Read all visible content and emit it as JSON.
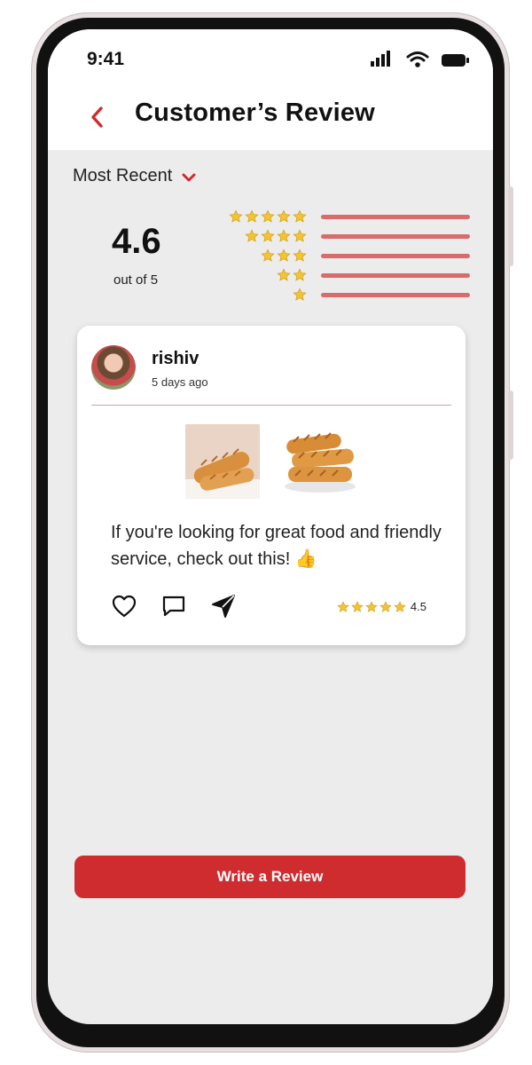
{
  "status_bar": {
    "time": "9:41"
  },
  "header": {
    "title": "Customer’s Review",
    "back_icon": "chevron-left-icon"
  },
  "sort": {
    "label": "Most Recent",
    "icon": "chevron-down-icon"
  },
  "summary": {
    "rating": "4.6",
    "out_of": "out of 5",
    "breakdown": [
      {
        "stars": 5,
        "fill": 1.0
      },
      {
        "stars": 4,
        "fill": 1.0
      },
      {
        "stars": 3,
        "fill": 1.0
      },
      {
        "stars": 2,
        "fill": 1.0
      },
      {
        "stars": 1,
        "fill": 1.0
      }
    ]
  },
  "review": {
    "username": "rishiv",
    "time_ago": "5 days ago",
    "text": "If you're looking for great food and friendly service, check out this! 👍",
    "rating": "4.5",
    "rating_stars": 5,
    "photos": [
      "food-photo-1",
      "food-photo-2"
    ]
  },
  "actions": {
    "like_icon": "heart-icon",
    "comment_icon": "comment-icon",
    "share_icon": "send-icon"
  },
  "cta": {
    "label": "Write a Review"
  },
  "colors": {
    "accent": "#cf2c2f",
    "bar": "#d96b6b",
    "star": "#f4c430"
  }
}
